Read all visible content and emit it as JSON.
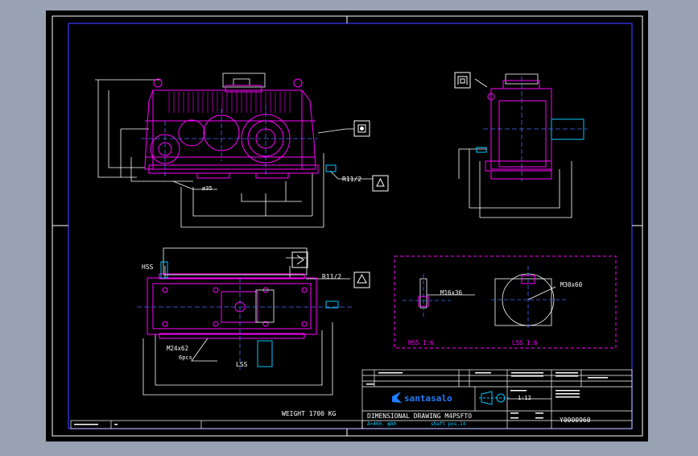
{
  "colors": {
    "background": "#98a2b2",
    "sheet": "#000000",
    "frame_white": "#ffffff",
    "border_blue": "#3a3aff",
    "part_magenta": "#ff00ff",
    "axis_blue": "#4a6cff",
    "cyan": "#00c8ff",
    "brand_blue": "#1e7fff"
  },
  "labels": {
    "diameter": "ø35",
    "drain_plug_top": "R11/2",
    "drain_plug_bottom": "R11/2",
    "hss": "HSS",
    "lss": "LSS",
    "thread": "M24x62",
    "qty": "6pcs",
    "weight": "WEIGHT 1700 KG",
    "m16": "M16x36",
    "m30": "M30x60",
    "detail_hss": "HSS 1:6",
    "detail_lss": "LSS 1:6"
  },
  "title_block": {
    "logo_text": "santasalo",
    "drawing_title": "DIMENSIONAL DRAWING M4PSFTO",
    "sub_left": "Δ=400.  ϕ80",
    "sub_right": "shaft pos.14",
    "scale": "1:12",
    "drawing_no": "Y0000960"
  },
  "icons": {
    "oil_fill": "oil-filler-icon",
    "oil_drain": "oil-drain-icon",
    "breather": "breather-icon",
    "lifting": "lifting-eye-icon"
  }
}
